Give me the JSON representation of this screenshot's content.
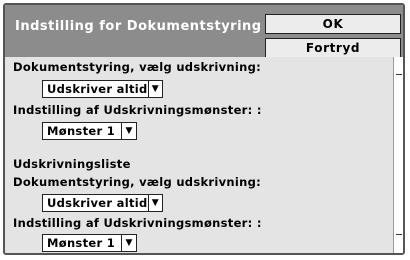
{
  "dialog": {
    "title": "Indstilling for Dokumentstyring",
    "ok_label": "OK",
    "cancel_label": "Fortryd"
  },
  "section1": {
    "mode_label": "Dokumentstyring, vælg udskrivning:",
    "mode_value": "Udskriver altid",
    "pattern_label": "Indstilling af Udskrivningsmønster: :",
    "pattern_value": "Mønster 1"
  },
  "section2": {
    "heading": "Udskrivningsliste",
    "mode_label": "Dokumentstyring, vælg udskrivning:",
    "mode_value": "Udskriver altid",
    "pattern_label": "Indstilling af Udskrivningsmønster: :",
    "pattern_value": "Mønster 1"
  },
  "icons": {
    "dropdown": "triangle-down-icon"
  }
}
